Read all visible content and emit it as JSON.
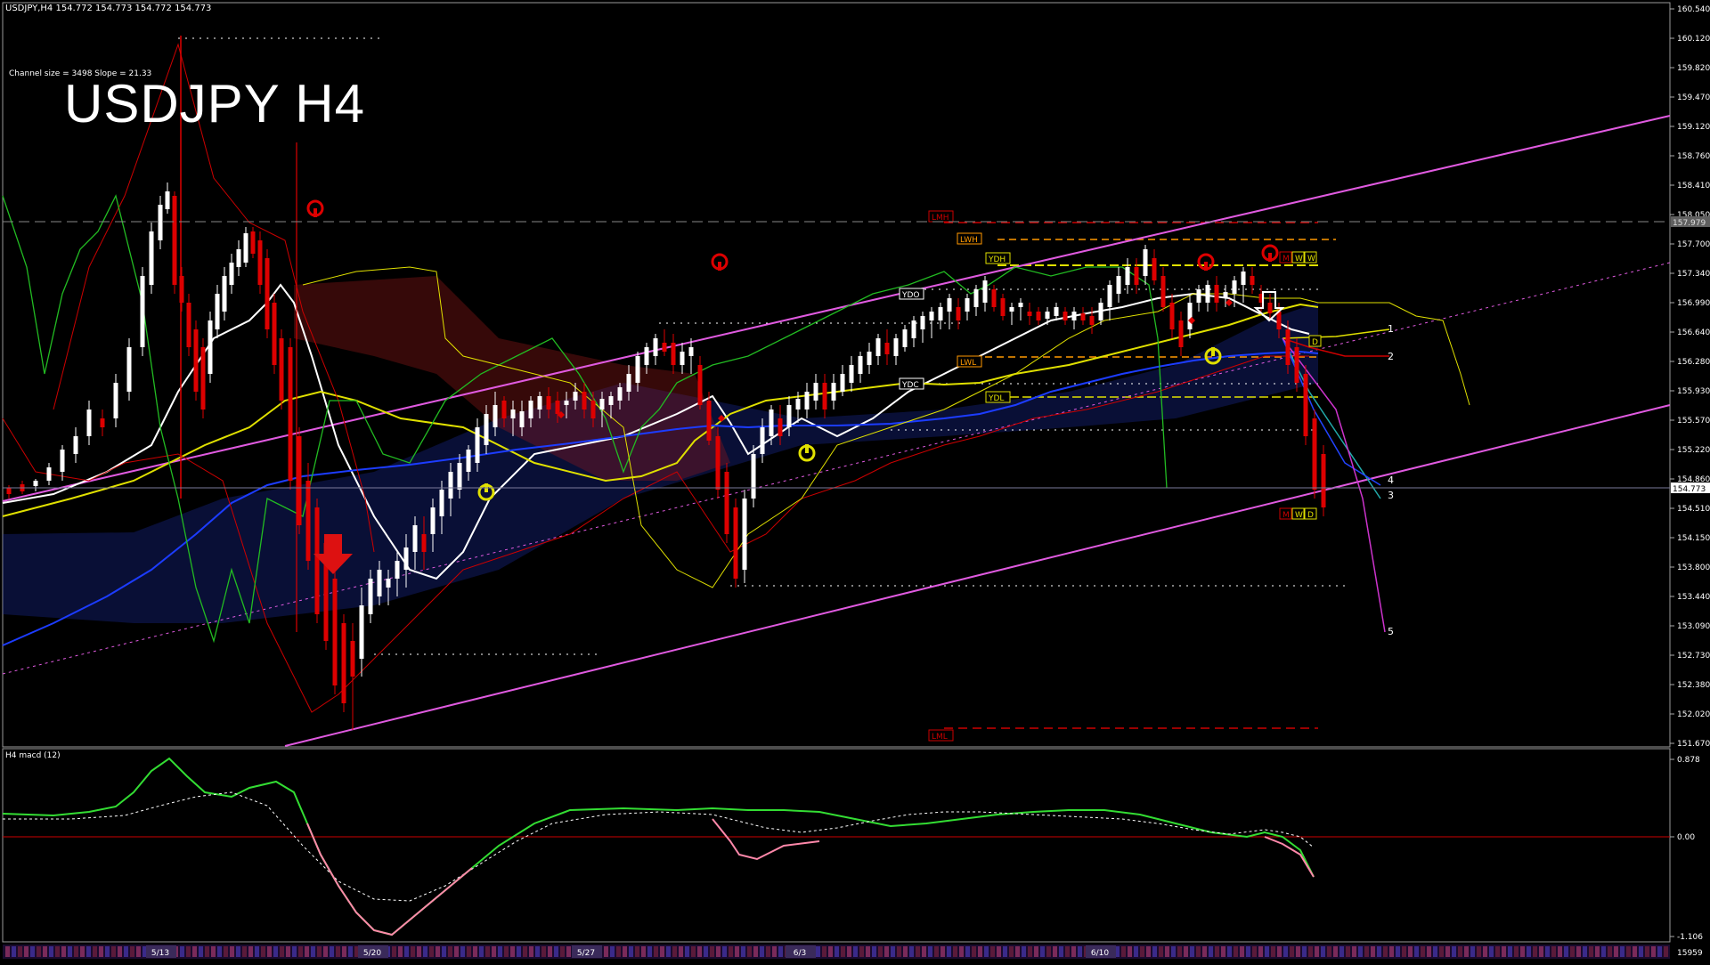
{
  "header": {
    "symbol_line": "USDJPY,H4  154.772 154.773 154.772 154.773",
    "channel_info": "Channel size = 3498 Slope = 21.33",
    "title": "USDJPY H4",
    "macd_label": "H4  macd (12)"
  },
  "price_axis": {
    "labels": [
      "160.540",
      "160.120",
      "159.820",
      "159.470",
      "159.120",
      "158.760",
      "158.410",
      "158.050",
      "157.700",
      "157.340",
      "156.990",
      "156.640",
      "156.280",
      "155.930",
      "155.570",
      "155.220",
      "154.860",
      "154.510",
      "154.150",
      "153.800",
      "153.440",
      "153.090",
      "152.730",
      "152.380",
      "152.020",
      "151.670"
    ],
    "current_price": "154.773",
    "marked_price": "157.979"
  },
  "macd_axis": {
    "labels": [
      "0.878",
      "0.00",
      "-1.106"
    ]
  },
  "date_axis": {
    "labels": [
      "5/13",
      "5/20",
      "5/27",
      "6/3",
      "6/10"
    ],
    "bottom_value": "15959"
  },
  "level_labels": {
    "lmh": "LMH",
    "lml": "LML",
    "lwh": "LWH",
    "lwl": "LWL",
    "ydh": "YDH",
    "ydl": "YDL",
    "ydo": "YDO",
    "ydc": "YDC"
  },
  "projection_numbers": [
    "1",
    "2",
    "3",
    "4",
    "5"
  ],
  "mwd_top": [
    "M",
    "W",
    "W"
  ],
  "mwd_bottom": [
    "M",
    "W",
    "D"
  ],
  "d_label": "D",
  "colors": {
    "bg": "#000000",
    "channel": "#e05ae0",
    "ma_white": "#ffffff",
    "ma_yellow": "#e0e000",
    "ma_blue": "#1c3cff",
    "bollinger": "#cc0000",
    "rsi_green": "#22bb22",
    "cloud_blue": "#1a2a9a",
    "cloud_red": "#9a1a1a",
    "macd_green": "#33dd33",
    "macd_pink": "#ff88aa"
  }
}
